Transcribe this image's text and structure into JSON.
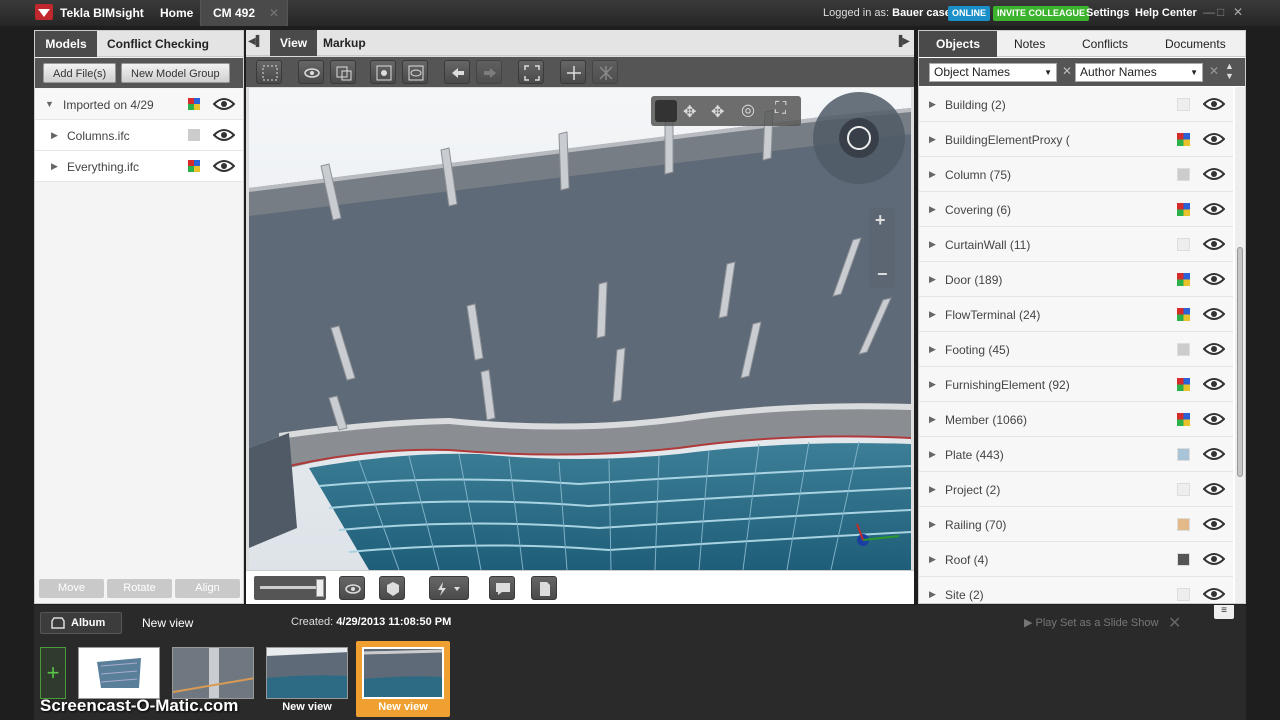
{
  "app": {
    "name": "Tekla BIMsight"
  },
  "titlebar": {
    "tabs": [
      {
        "label": "Home"
      },
      {
        "label": "CM 492"
      }
    ],
    "logged_prefix": "Logged in as:",
    "user": "Bauer casey",
    "online_badge": "ONLINE",
    "invite_badge": "INVITE COLLEAGUE",
    "settings": "Settings",
    "help": "Help Center"
  },
  "left": {
    "tabs": [
      {
        "label": "Models"
      },
      {
        "label": "Conflict Checking"
      }
    ],
    "add_files": "Add File(s)",
    "new_group": "New Model Group",
    "tree": [
      {
        "label": "Imported on 4/29",
        "expanded": true
      },
      {
        "label": "Columns.ifc"
      },
      {
        "label": "Everything.ifc"
      }
    ],
    "bottom_buttons": [
      {
        "label": "Move"
      },
      {
        "label": "Rotate"
      },
      {
        "label": "Align"
      }
    ]
  },
  "center": {
    "tabs": [
      {
        "label": "View"
      },
      {
        "label": "Markup"
      }
    ]
  },
  "right": {
    "tabs": [
      {
        "label": "Objects"
      },
      {
        "label": "Notes"
      },
      {
        "label": "Conflicts"
      },
      {
        "label": "Documents"
      }
    ],
    "filter1": "Object Names",
    "filter2": "Author Names",
    "objects": [
      {
        "label": "Building (2)",
        "chip": "#eeeeee"
      },
      {
        "label": "BuildingElementProxy (",
        "chip": "multi"
      },
      {
        "label": "Column (75)",
        "chip": "#cccccc"
      },
      {
        "label": "Covering (6)",
        "chip": "multi"
      },
      {
        "label": "CurtainWall (11)",
        "chip": "#eeeeee"
      },
      {
        "label": "Door (189)",
        "chip": "multi"
      },
      {
        "label": "FlowTerminal (24)",
        "chip": "multi"
      },
      {
        "label": "Footing (45)",
        "chip": "#cccccc"
      },
      {
        "label": "FurnishingElement (92)",
        "chip": "multi"
      },
      {
        "label": "Member (1066)",
        "chip": "multi"
      },
      {
        "label": "Plate (443)",
        "chip": "#a9c4d6"
      },
      {
        "label": "Project (2)",
        "chip": "#eeeeee"
      },
      {
        "label": "Railing (70)",
        "chip": "#e3b98a"
      },
      {
        "label": "Roof (4)",
        "chip": "#555555"
      },
      {
        "label": "Site (2)",
        "chip": "#eeeeee"
      }
    ]
  },
  "album": {
    "button": "Album",
    "view_name": "New view",
    "created_label": "Created:",
    "created_value": "4/29/2013 11:08:50 PM",
    "slideshow": "Play Set as a Slide Show",
    "thumbs": [
      {
        "caption": ""
      },
      {
        "caption": ""
      },
      {
        "caption": "New view"
      },
      {
        "caption": "New view"
      }
    ]
  },
  "watermark": "Screencast-O-Matic.com",
  "colors": {
    "accent": "#f0a030",
    "dark": "#4a4a4a"
  }
}
